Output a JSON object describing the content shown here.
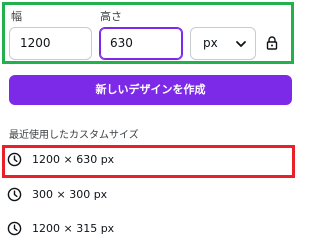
{
  "fields": {
    "width_label": "幅",
    "height_label": "高さ",
    "width_value": "1200",
    "height_value": "630",
    "unit_value": "px"
  },
  "create_button_label": "新しいデザインを作成",
  "recent": {
    "title": "最近使用したカスタムサイズ",
    "items": [
      {
        "label": "1200 × 630 px"
      },
      {
        "label": "300 × 300 px"
      },
      {
        "label": "1200 × 315 px"
      }
    ]
  },
  "colors": {
    "accent": "#7d2ae8",
    "highlight_green": "#22b14c",
    "highlight_red": "#e8202a"
  },
  "icons": {
    "unit_dropdown": "chevron-down-icon",
    "aspect_lock": "lock-icon",
    "recent_item": "clock-icon"
  }
}
